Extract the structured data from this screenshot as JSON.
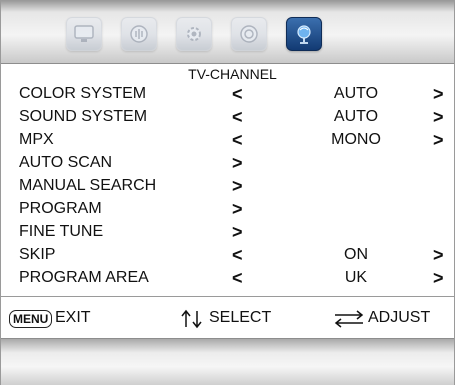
{
  "header": {
    "tabs": [
      {
        "icon": "tv-picture-icon",
        "active": false
      },
      {
        "icon": "sound-icon",
        "active": false
      },
      {
        "icon": "setup-icon",
        "active": false
      },
      {
        "icon": "feature-icon",
        "active": false
      },
      {
        "icon": "tv-channel-icon",
        "active": true
      }
    ],
    "accent_color": "#1d4f8f"
  },
  "menu": {
    "title": "TV-CHANNEL",
    "rows": [
      {
        "label": "COLOR SYSTEM",
        "left_arrow": "<",
        "value": "AUTO",
        "right_arrow": ">"
      },
      {
        "label": "SOUND SYSTEM",
        "left_arrow": "<",
        "value": "AUTO",
        "right_arrow": ">"
      },
      {
        "label": "MPX",
        "left_arrow": "<",
        "value": "MONO",
        "right_arrow": ">"
      },
      {
        "label": "AUTO SCAN",
        "enter_arrow": ">"
      },
      {
        "label": "MANUAL SEARCH",
        "enter_arrow": ">"
      },
      {
        "label": "PROGRAM",
        "enter_arrow": ">"
      },
      {
        "label": "FINE TUNE",
        "enter_arrow": ">"
      },
      {
        "label": "SKIP",
        "left_arrow": "<",
        "value": "ON",
        "right_arrow": ">"
      },
      {
        "label": "PROGRAM AREA",
        "left_arrow": "<",
        "value": "UK",
        "right_arrow": ">"
      }
    ]
  },
  "footer": {
    "menu_key": "MENU",
    "exit_label": "EXIT",
    "select_label": "SELECT",
    "adjust_label": "ADJUST"
  }
}
